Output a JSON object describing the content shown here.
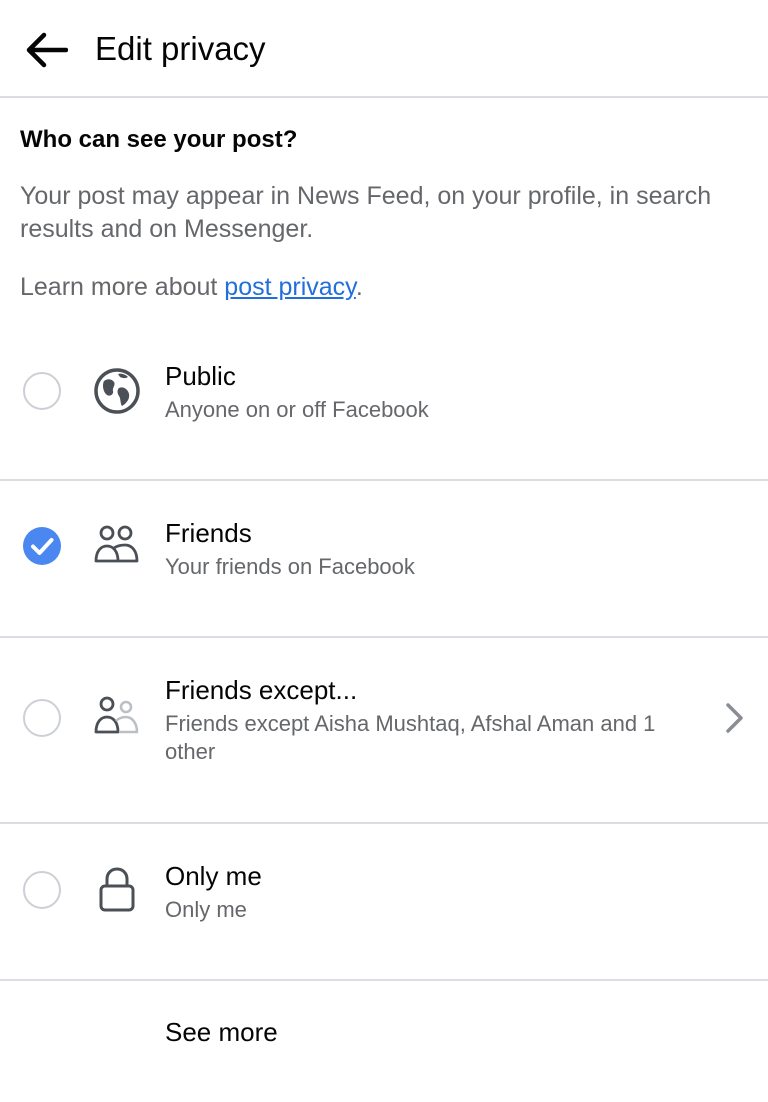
{
  "header": {
    "title": "Edit privacy",
    "back_icon": "arrow-left-icon"
  },
  "intro": {
    "question": "Who can see your post?",
    "description": "Your post may appear in News Feed, on your profile, in search results and on Messenger.",
    "learn_more_prefix": "Learn more about ",
    "learn_more_link": "post privacy",
    "learn_more_suffix": "."
  },
  "options": [
    {
      "title": "Public",
      "subtitle": "Anyone on or off Facebook",
      "icon": "globe-icon",
      "selected": false
    },
    {
      "title": "Friends",
      "subtitle": "Your friends on Facebook",
      "icon": "friends-icon",
      "selected": true
    },
    {
      "title": "Friends except...",
      "subtitle": "Friends except Aisha Mushtaq, Afshal Aman and 1 other",
      "icon": "friends-except-icon",
      "selected": false
    },
    {
      "title": "Only me",
      "subtitle": "Only me",
      "icon": "lock-icon",
      "selected": false
    }
  ],
  "see_more": "See more",
  "colors": {
    "accent": "#4b87f0",
    "link": "#216fdb",
    "secondary_text": "#65676b",
    "divider": "#dadde1"
  }
}
